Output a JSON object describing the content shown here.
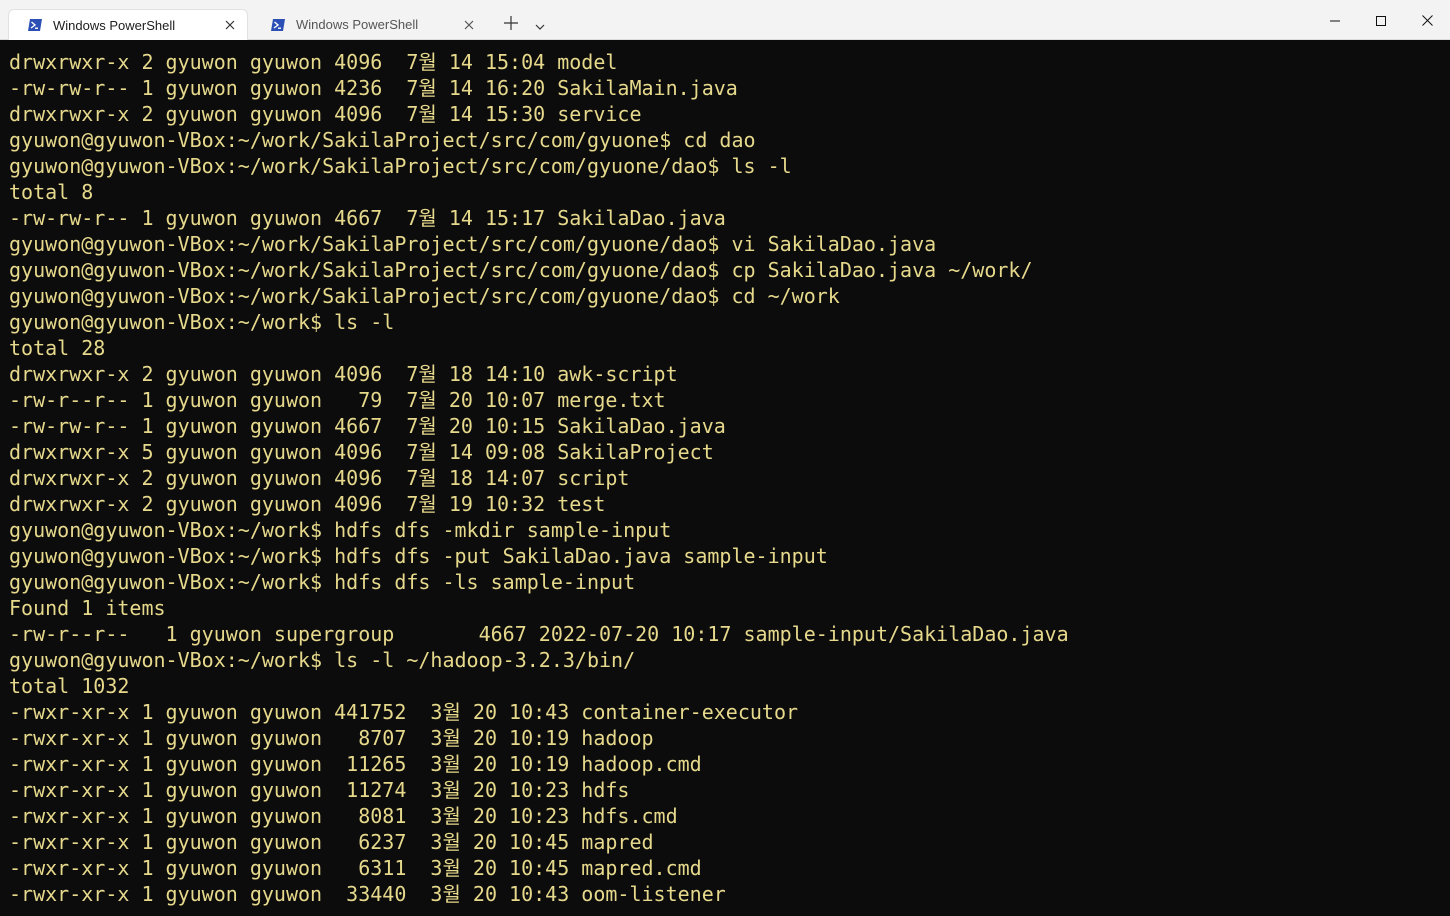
{
  "tabs": [
    {
      "label": "Windows PowerShell",
      "active": true
    },
    {
      "label": "Windows PowerShell",
      "active": false
    }
  ],
  "colors": {
    "background": "#0c0c0c",
    "text": "#e6d98c",
    "titlebar": "#f3f3f3",
    "powershell_icon": "#2b4fb4"
  },
  "icons": {
    "tab_icon": "powershell-icon",
    "close": "close-icon",
    "new_tab": "plus-icon",
    "dropdown": "chevron-down-icon",
    "minimize": "minimize-icon",
    "maximize": "maximize-icon",
    "window_close": "window-close-icon"
  },
  "terminal": {
    "lines": [
      "drwxrwxr-x 2 gyuwon gyuwon 4096  7월 14 15:04 model",
      "-rw-rw-r-- 1 gyuwon gyuwon 4236  7월 14 16:20 SakilaMain.java",
      "drwxrwxr-x 2 gyuwon gyuwon 4096  7월 14 15:30 service",
      "gyuwon@gyuwon-VBox:~/work/SakilaProject/src/com/gyuone$ cd dao",
      "gyuwon@gyuwon-VBox:~/work/SakilaProject/src/com/gyuone/dao$ ls -l",
      "total 8",
      "-rw-rw-r-- 1 gyuwon gyuwon 4667  7월 14 15:17 SakilaDao.java",
      "gyuwon@gyuwon-VBox:~/work/SakilaProject/src/com/gyuone/dao$ vi SakilaDao.java",
      "gyuwon@gyuwon-VBox:~/work/SakilaProject/src/com/gyuone/dao$ cp SakilaDao.java ~/work/",
      "gyuwon@gyuwon-VBox:~/work/SakilaProject/src/com/gyuone/dao$ cd ~/work",
      "gyuwon@gyuwon-VBox:~/work$ ls -l",
      "total 28",
      "drwxrwxr-x 2 gyuwon gyuwon 4096  7월 18 14:10 awk-script",
      "-rw-r--r-- 1 gyuwon gyuwon   79  7월 20 10:07 merge.txt",
      "-rw-rw-r-- 1 gyuwon gyuwon 4667  7월 20 10:15 SakilaDao.java",
      "drwxrwxr-x 5 gyuwon gyuwon 4096  7월 14 09:08 SakilaProject",
      "drwxrwxr-x 2 gyuwon gyuwon 4096  7월 18 14:07 script",
      "drwxrwxr-x 2 gyuwon gyuwon 4096  7월 19 10:32 test",
      "gyuwon@gyuwon-VBox:~/work$ hdfs dfs -mkdir sample-input",
      "gyuwon@gyuwon-VBox:~/work$ hdfs dfs -put SakilaDao.java sample-input",
      "gyuwon@gyuwon-VBox:~/work$ hdfs dfs -ls sample-input",
      "Found 1 items",
      "-rw-r--r--   1 gyuwon supergroup       4667 2022-07-20 10:17 sample-input/SakilaDao.java",
      "gyuwon@gyuwon-VBox:~/work$ ls -l ~/hadoop-3.2.3/bin/",
      "total 1032",
      "-rwxr-xr-x 1 gyuwon gyuwon 441752  3월 20 10:43 container-executor",
      "-rwxr-xr-x 1 gyuwon gyuwon   8707  3월 20 10:19 hadoop",
      "-rwxr-xr-x 1 gyuwon gyuwon  11265  3월 20 10:19 hadoop.cmd",
      "-rwxr-xr-x 1 gyuwon gyuwon  11274  3월 20 10:23 hdfs",
      "-rwxr-xr-x 1 gyuwon gyuwon   8081  3월 20 10:23 hdfs.cmd",
      "-rwxr-xr-x 1 gyuwon gyuwon   6237  3월 20 10:45 mapred",
      "-rwxr-xr-x 1 gyuwon gyuwon   6311  3월 20 10:45 mapred.cmd",
      "-rwxr-xr-x 1 gyuwon gyuwon  33440  3월 20 10:43 oom-listener"
    ]
  }
}
